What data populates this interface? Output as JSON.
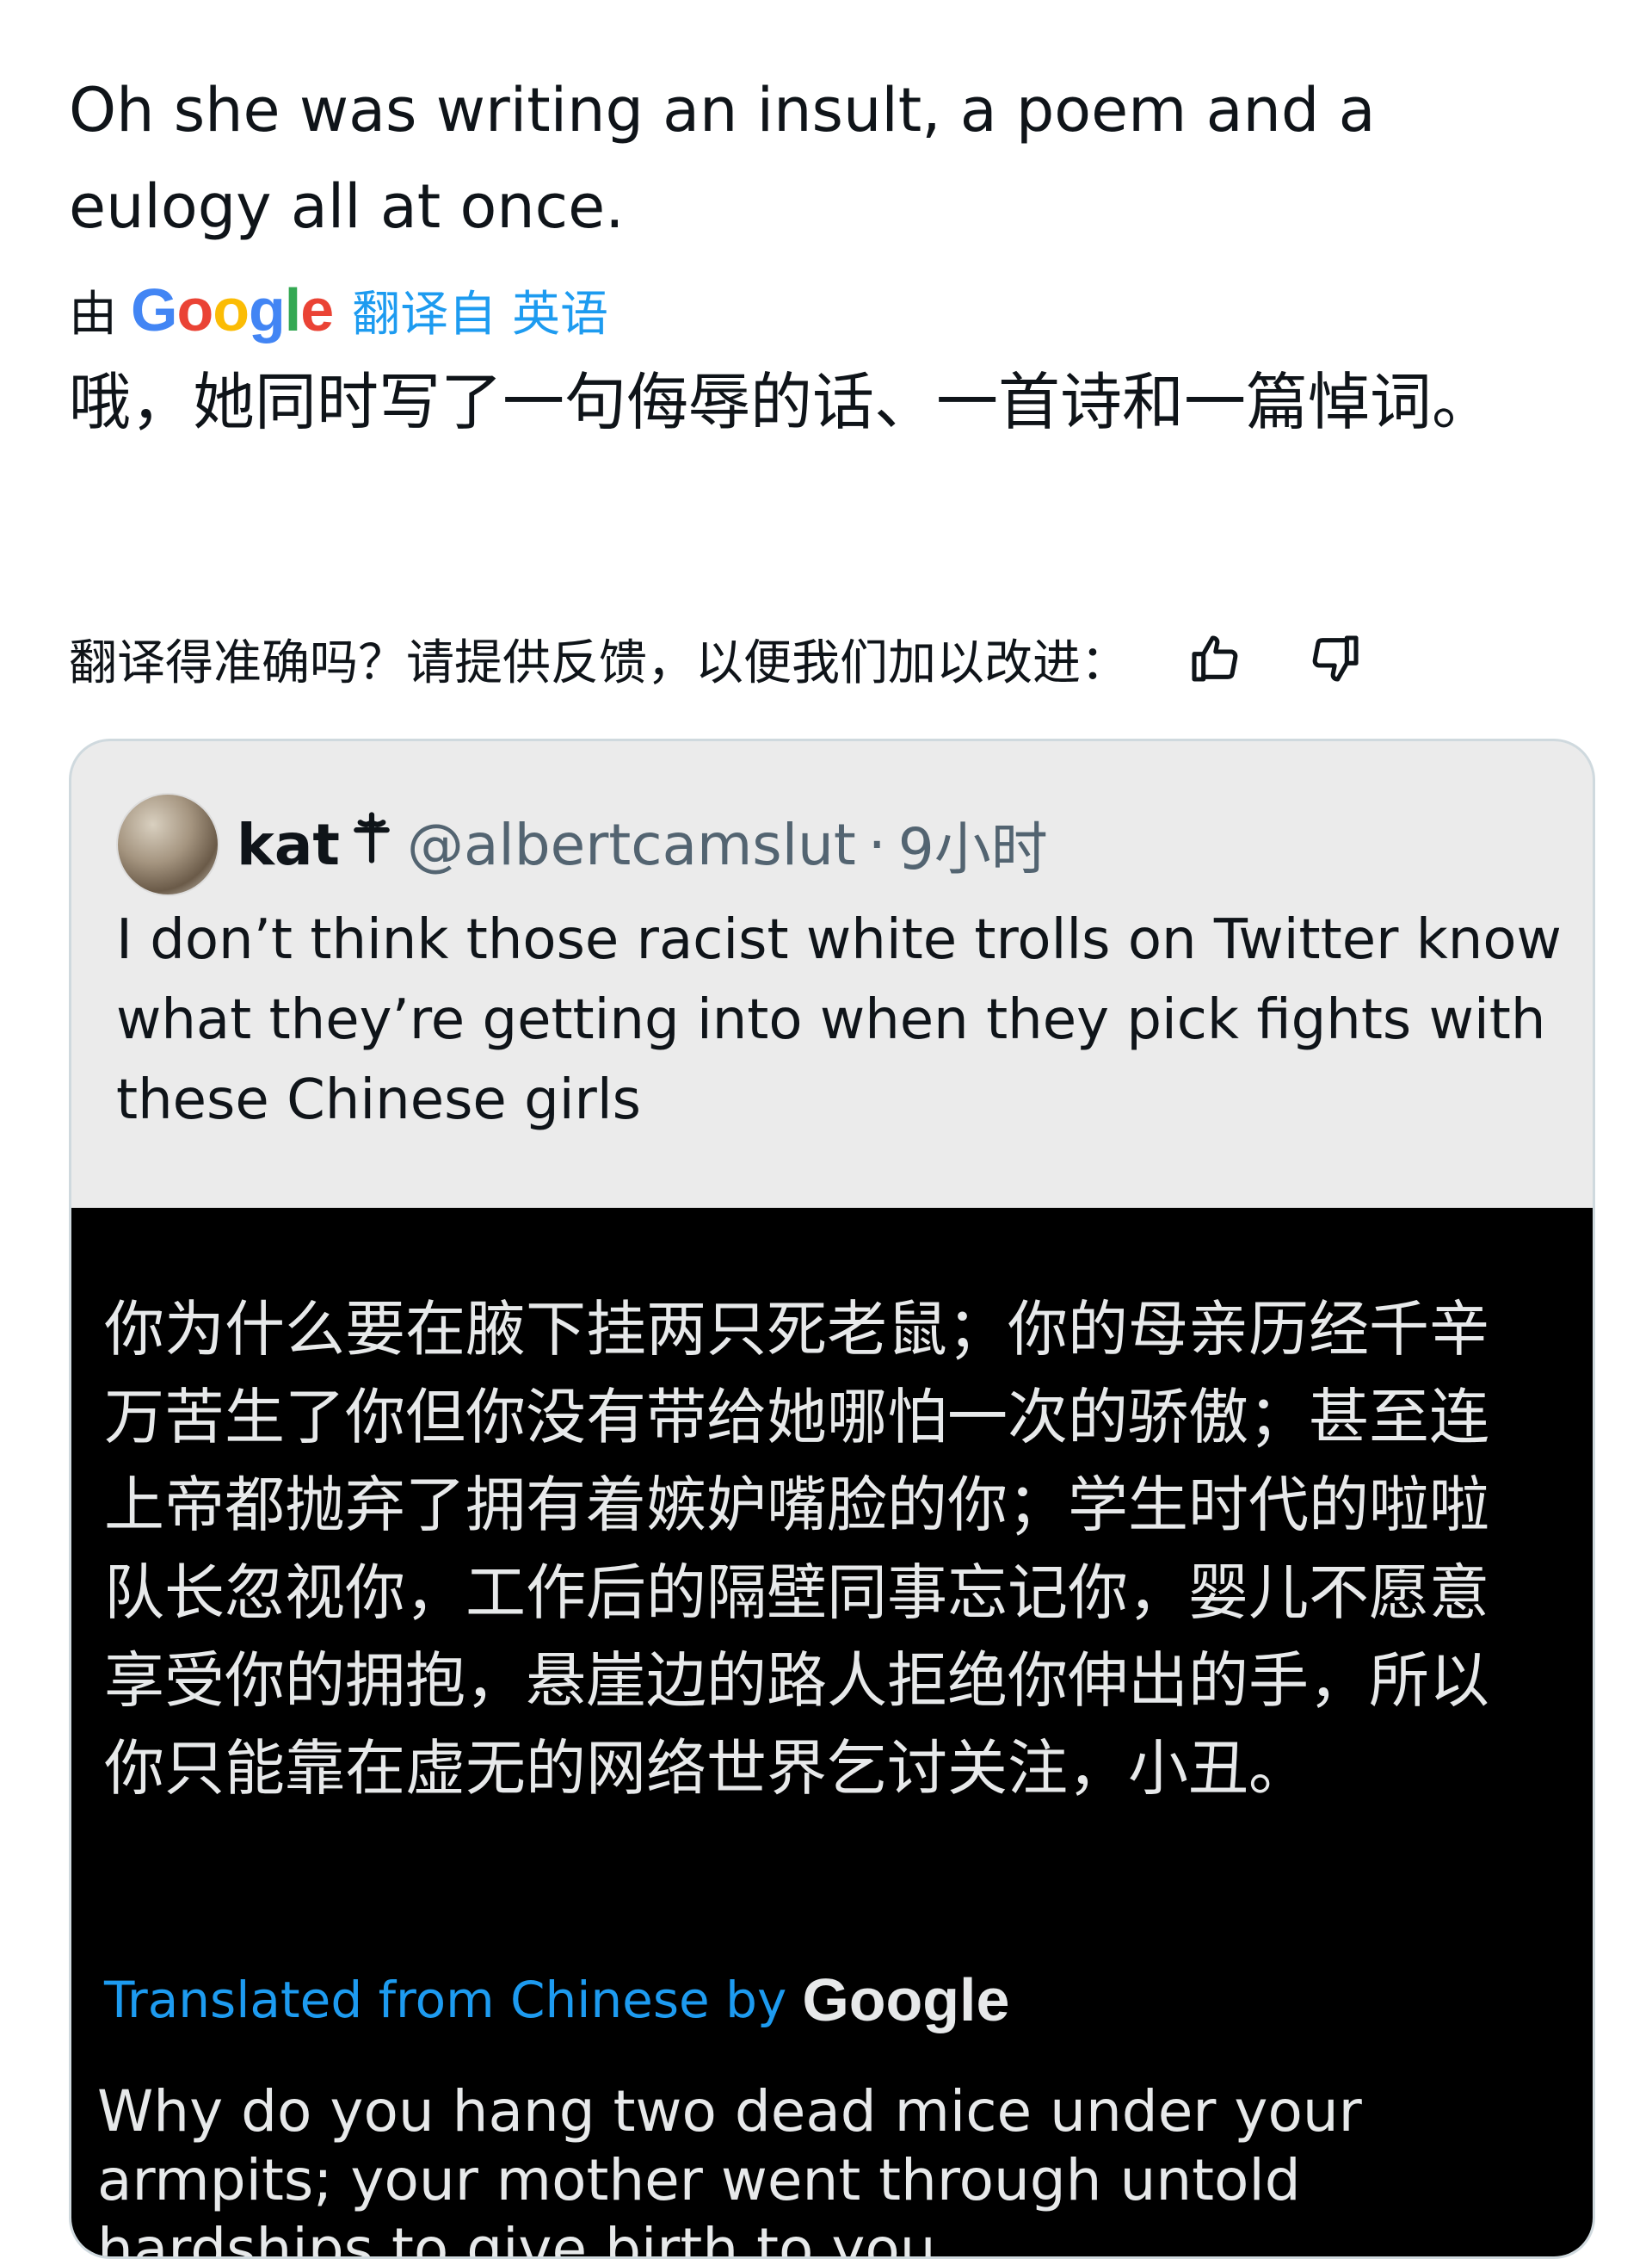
{
  "tweet": {
    "text": "Oh she was writing an insult, a poem and a eulogy all at once.",
    "translated_prefix": "由",
    "translated_brand": "Google",
    "translated_from": "翻译自 英语",
    "translation": "哦，她同时写了一句侮辱的话、一首诗和一篇悼词。",
    "feedback_prompt": "翻译得准确吗？请提供反馈，以便我们加以改进："
  },
  "quote": {
    "name": "kat",
    "name_icon": "cross-icon",
    "handle": "@albertcamslut",
    "separator": "·",
    "time": "9小时",
    "text": "I don’t think those racist white trolls on Twitter know what they’re getting into when they pick fights with these Chinese girls",
    "image": {
      "chinese_text": "你为什么要在腋下挂两只死老鼠；你的母亲历经千辛万苦生了你但你没有带给她哪怕一次的骄傲；甚至连上帝都抛弃了拥有着嫉妒嘴脸的你；学生时代的啦啦队长忽视你，工作后的隔壁同事忘记你，婴儿不愿意享受你的拥抱，悬崖边的路人拒绝你伸出的手，所以你只能靠在虚无的网络世界乞讨关注，小丑。",
      "translated_label": "Translated from Chinese by",
      "translated_brand": "Google",
      "english_text": "Why do you hang two dead mice under your armpits; your mother went through untold hardships to give birth to you"
    }
  },
  "colors": {
    "accent_blue": "#1d9bf0",
    "text_primary": "#0f1419",
    "text_secondary": "#536471",
    "quote_bg": "#ebebeb",
    "image_bg": "#000000"
  }
}
